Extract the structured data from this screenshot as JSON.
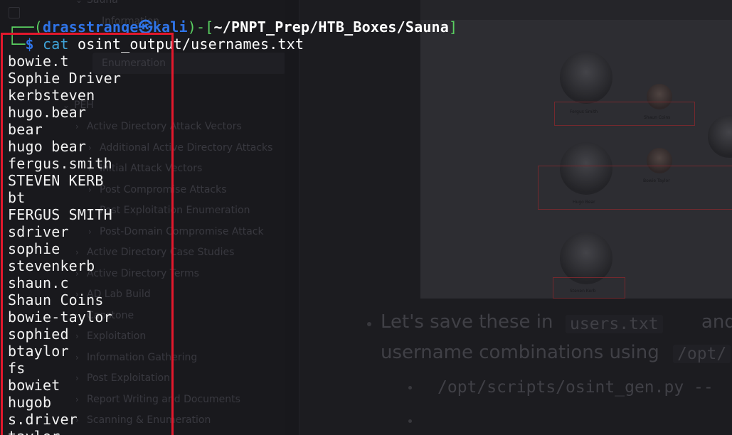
{
  "background_app": {
    "sidebar": {
      "top_items": [
        "Sauna",
        "Information",
        "Enumeration"
      ],
      "selected_item": "Enumeration",
      "section_label": "PEH",
      "items": [
        {
          "label": "Active Directory Attack Vectors",
          "indent": 0
        },
        {
          "label": "Additional Active Directory Attacks",
          "indent": 1
        },
        {
          "label": "Initial Attack Vectors",
          "indent": 1
        },
        {
          "label": "Post Compromise Attacks",
          "indent": 1
        },
        {
          "label": "Post Exploitation Enumeration",
          "indent": 1
        },
        {
          "label": "Post-Domain Compromise Attack",
          "indent": 1
        },
        {
          "label": "Active Directory Case Studies",
          "indent": 0
        },
        {
          "label": "Active Directory Terms",
          "indent": 0
        },
        {
          "label": "AD Lab Build",
          "indent": 0
        },
        {
          "label": "Capstone",
          "indent": 0
        },
        {
          "label": "Exploitation",
          "indent": 0
        },
        {
          "label": "Information Gathering",
          "indent": 0
        },
        {
          "label": "Post Exploitation",
          "indent": 0
        },
        {
          "label": "Report Writing and Documents",
          "indent": 0
        },
        {
          "label": "Scanning & Enumeration",
          "indent": 0
        }
      ]
    },
    "screenshot": {
      "people": [
        {
          "name": "Fergus Smith"
        },
        {
          "name": "Shaun Coins"
        },
        {
          "name": "Hugo Bear"
        },
        {
          "name": "Bowie Taylor"
        },
        {
          "name": "Steven Kerb"
        }
      ]
    },
    "notes": {
      "line1_prefix": "Let's save these in",
      "line1_code": "users.txt",
      "line1_suffix": "and",
      "line2_prefix": "username combinations using",
      "line2_code": "/opt/",
      "sub_bullet_code": "/opt/scripts/osint_gen.py --"
    }
  },
  "terminal": {
    "prompt": {
      "corner_top": "┌──(",
      "user": "drasstrange",
      "at": "㉿",
      "host": "kali",
      "mid": ")-[",
      "path": "~/PNPT_Prep/HTB_Boxes/Sauna",
      "close": "]",
      "corner_bottom": "└─",
      "dollar": "$"
    },
    "command": "cat",
    "argument": "osint_output/usernames.txt",
    "output": [
      "bowie.t",
      "Sophie Driver",
      "kerbsteven",
      "hugo.bear",
      "bear",
      "hugo bear",
      "fergus.smith",
      "STEVEN KERB",
      "bt",
      "FERGUS SMITH",
      "sdriver",
      "sophie",
      "stevenkerb",
      "shaun.c",
      "Shaun Coins",
      "bowie-taylor",
      "sophied",
      "btaylor",
      "fs",
      "bowiet",
      "hugob",
      "s.driver",
      "taylor"
    ],
    "highlight_color": "#e3182c"
  }
}
